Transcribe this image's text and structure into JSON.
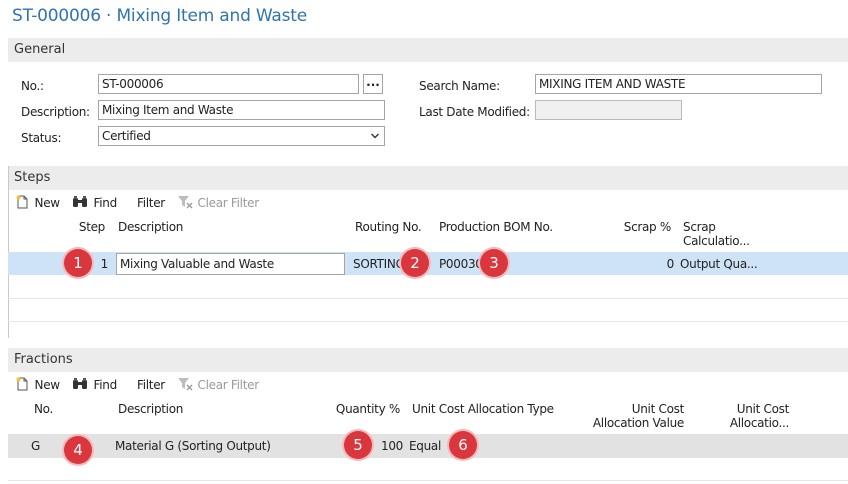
{
  "page": {
    "title": "ST-000006 · Mixing Item and Waste"
  },
  "general": {
    "heading": "General",
    "no_label": "No.:",
    "no_value": "ST-000006",
    "assist_label": "...",
    "description_label": "Description:",
    "description_value": "Mixing Item and Waste",
    "status_label": "Status:",
    "status_value": "Certified",
    "search_name_label": "Search Name:",
    "search_name_value": "MIXING ITEM AND WASTE",
    "last_modified_label": "Last Date Modified:",
    "last_modified_value": ""
  },
  "steps": {
    "heading": "Steps",
    "toolbar": {
      "new": "New",
      "find": "Find",
      "filter": "Filter",
      "clear_filter": "Clear Filter"
    },
    "columns": {
      "step": "Step",
      "description": "Description",
      "routing": "Routing No.",
      "bom": "Production BOM No.",
      "scrap_pct": "Scrap %",
      "scrap_calc_1": "Scrap",
      "scrap_calc_2": "Calculatio..."
    },
    "rows": [
      {
        "step": "1",
        "description": "Mixing Valuable and Waste",
        "routing": "SORTING",
        "bom": "P00030",
        "scrap_pct": "0",
        "scrap_calc": "Output Qua..."
      }
    ]
  },
  "fractions": {
    "heading": "Fractions",
    "toolbar": {
      "new": "New",
      "find": "Find",
      "filter": "Filter",
      "clear_filter": "Clear Filter"
    },
    "columns": {
      "no": "No.",
      "description": "Description",
      "quantity_pct": "Quantity %",
      "alloc_type": "Unit Cost Allocation Type",
      "alloc_value_1": "Unit Cost",
      "alloc_value_2": "Allocation Value",
      "unit_cost_1": "Unit Cost",
      "unit_cost_2": "Allocatio..."
    },
    "rows": [
      {
        "no": "G",
        "description": "Material G (Sorting Output)",
        "quantity_pct": "100",
        "alloc_type": "Equal"
      }
    ]
  },
  "callouts": [
    "1",
    "2",
    "3",
    "4",
    "5",
    "6"
  ],
  "colors": {
    "title": "#2f73b4",
    "selected_row": "#cfe3f6",
    "band": "#ececec",
    "badge": "#d9363e"
  },
  "icons": {
    "new": "new-document-icon",
    "find": "binoculars-icon",
    "clear_filter": "clear-filter-icon",
    "status_dropdown": "chevron-down-icon"
  }
}
